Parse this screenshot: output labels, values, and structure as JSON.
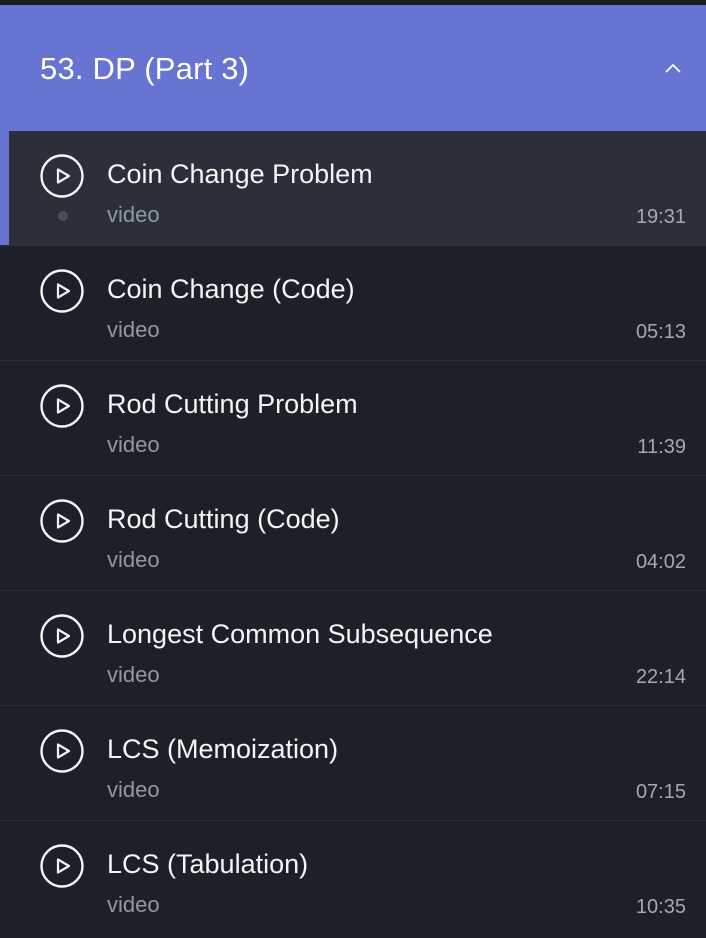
{
  "section": {
    "title": "53. DP (Part 3)",
    "expanded": true,
    "header_color": "#6874d2",
    "chevron_icon": "chevron-up-icon"
  },
  "items": [
    {
      "title": "Coin Change Problem",
      "type": "video",
      "duration": "19:31",
      "active": true,
      "icon": "play-circle-icon"
    },
    {
      "title": "Coin Change (Code)",
      "type": "video",
      "duration": "05:13",
      "active": false,
      "icon": "play-circle-icon"
    },
    {
      "title": "Rod Cutting Problem",
      "type": "video",
      "duration": "11:39",
      "active": false,
      "icon": "play-circle-icon"
    },
    {
      "title": "Rod Cutting (Code)",
      "type": "video",
      "duration": "04:02",
      "active": false,
      "icon": "play-circle-icon"
    },
    {
      "title": "Longest Common Subsequence",
      "type": "video",
      "duration": "22:14",
      "active": false,
      "icon": "play-circle-icon"
    },
    {
      "title": "LCS (Memoization)",
      "type": "video",
      "duration": "07:15",
      "active": false,
      "icon": "play-circle-icon"
    },
    {
      "title": "LCS (Tabulation)",
      "type": "video",
      "duration": "10:35",
      "active": false,
      "icon": "play-circle-icon"
    }
  ]
}
